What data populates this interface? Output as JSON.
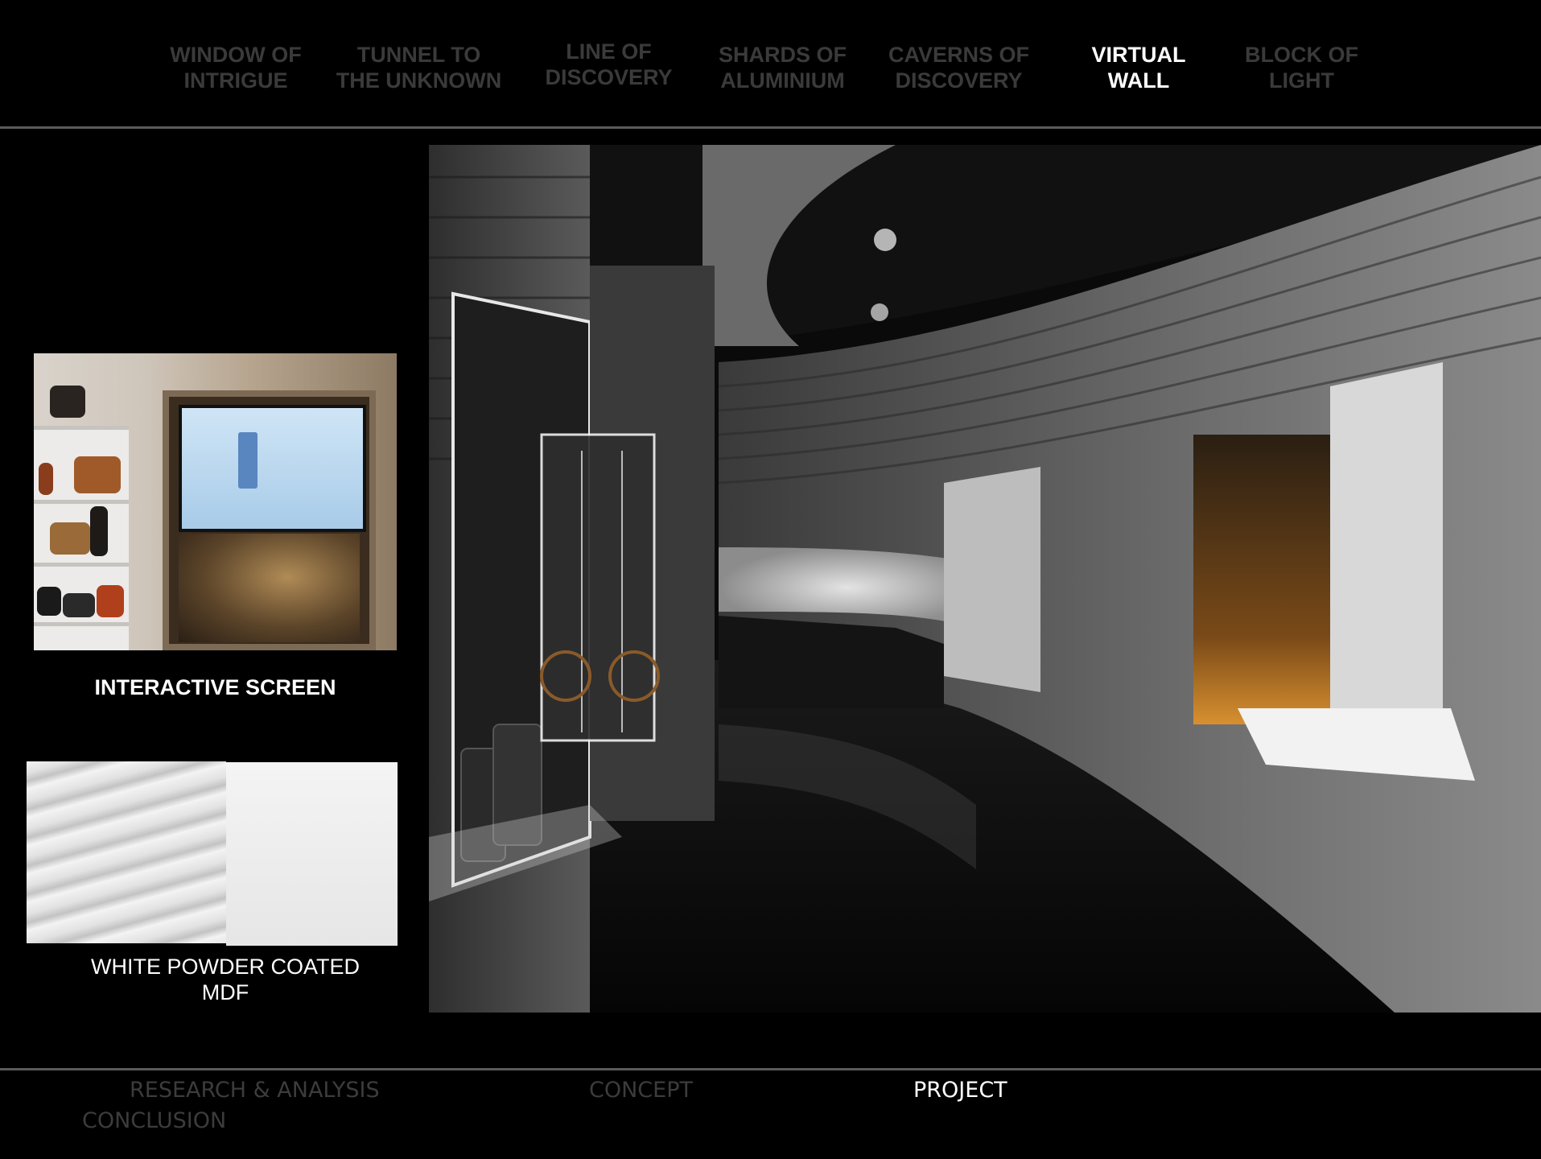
{
  "top_nav": {
    "items": [
      {
        "label": "WINDOW OF\nINTRIGUE",
        "active": false
      },
      {
        "label": "TUNNEL TO\nTHE UNKNOWN",
        "active": false
      },
      {
        "label": "LINE OF\nDISCOVERY",
        "active": false
      },
      {
        "label": "SHARDS OF\nALUMINIUM",
        "active": false
      },
      {
        "label": "CAVERNS OF\nDISCOVERY",
        "active": false
      },
      {
        "label": "VIRTUAL\nWALL",
        "active": true
      },
      {
        "label": "BLOCK OF\nLIGHT",
        "active": false
      }
    ]
  },
  "left_panel": {
    "screen_caption": "INTERACTIVE SCREEN",
    "material_caption": "WHITE POWDER COATED\nMDF"
  },
  "bottom_nav": {
    "items": [
      {
        "label": "RESEARCH & ANALYSIS",
        "active": false
      },
      {
        "label": "CONCEPT",
        "active": false
      },
      {
        "label": "PROJECT",
        "active": true
      },
      {
        "label": "CONCLUSION",
        "active": false
      }
    ]
  },
  "colors": {
    "background": "#000000",
    "inactive_text": "#3a3a3a",
    "active_text": "#ffffff",
    "rule": "#5a5a5a"
  }
}
